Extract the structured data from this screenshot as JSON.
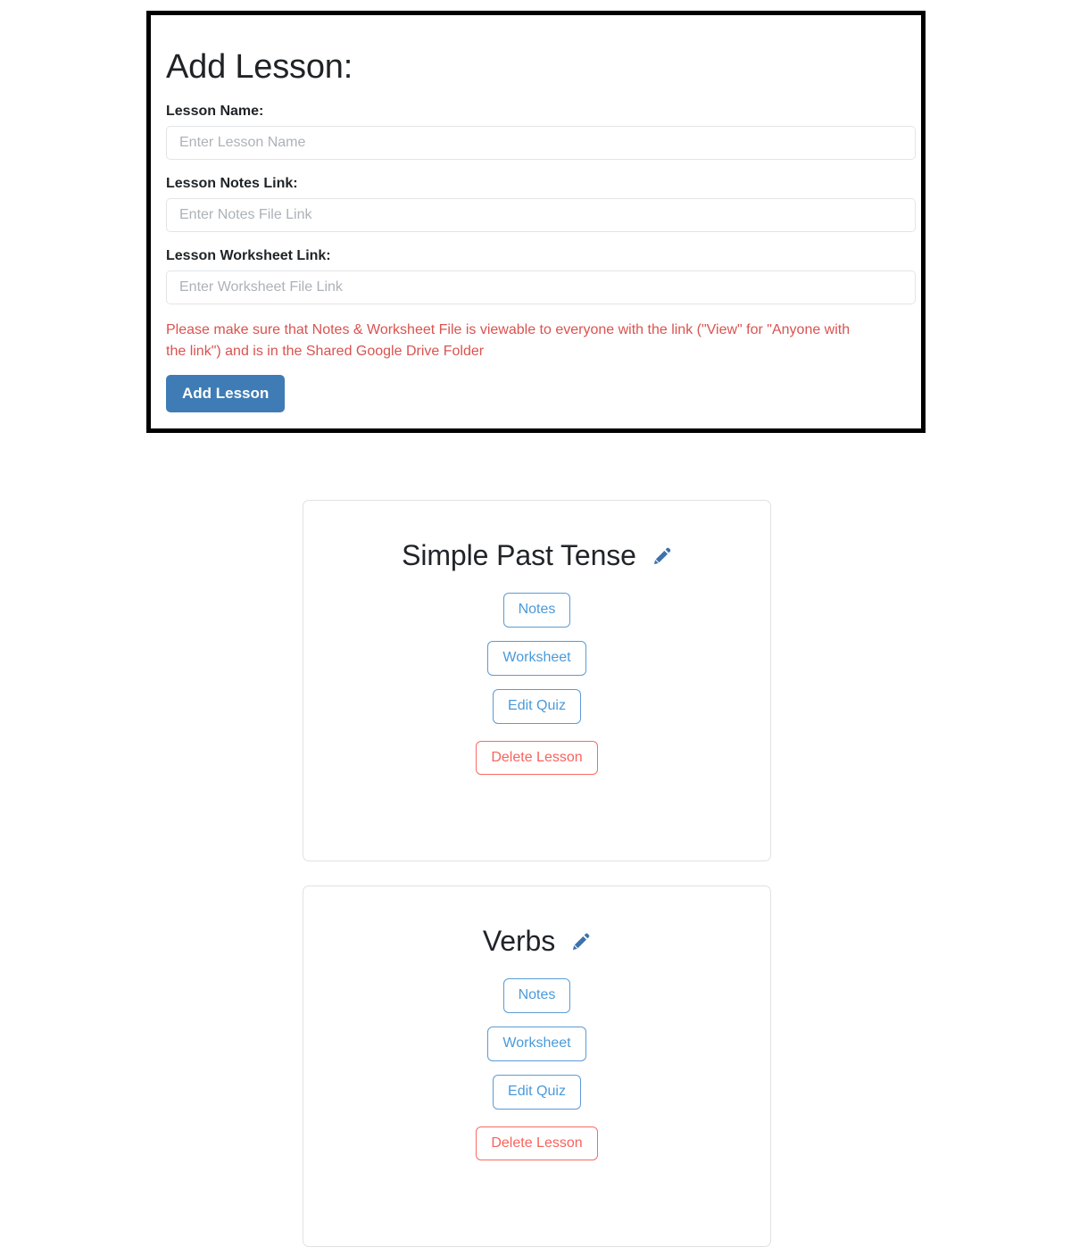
{
  "add_panel": {
    "title": "Add Lesson:",
    "fields": [
      {
        "label": "Lesson Name:",
        "placeholder": "Enter Lesson Name",
        "value": ""
      },
      {
        "label": "Lesson Notes Link:",
        "placeholder": "Enter Notes File Link",
        "value": ""
      },
      {
        "label": "Lesson Worksheet Link:",
        "placeholder": "Enter Worksheet File Link",
        "value": ""
      }
    ],
    "warning": "Please make sure that Notes & Worksheet File is viewable to everyone with the link (\"View\" for \"Anyone with the link\") and is in the Shared Google Drive Folder",
    "submit_label": "Add Lesson"
  },
  "lessons": [
    {
      "title": "Simple Past Tense",
      "edit_icon": "pencil-icon",
      "notes_label": "Notes",
      "worksheet_label": "Worksheet",
      "edit_quiz_label": "Edit Quiz",
      "delete_label": "Delete Lesson"
    },
    {
      "title": "Verbs",
      "edit_icon": "pencil-icon",
      "notes_label": "Notes",
      "worksheet_label": "Worksheet",
      "edit_quiz_label": "Edit Quiz",
      "delete_label": "Delete Lesson"
    }
  ],
  "colors": {
    "primary_button": "#3f7cb5",
    "warning_text": "#d9534f",
    "outline_blue": "#5b9bd5",
    "outline_red": "#fa6b64",
    "panel_border": "#000000",
    "card_border": "#dfe1e3"
  }
}
